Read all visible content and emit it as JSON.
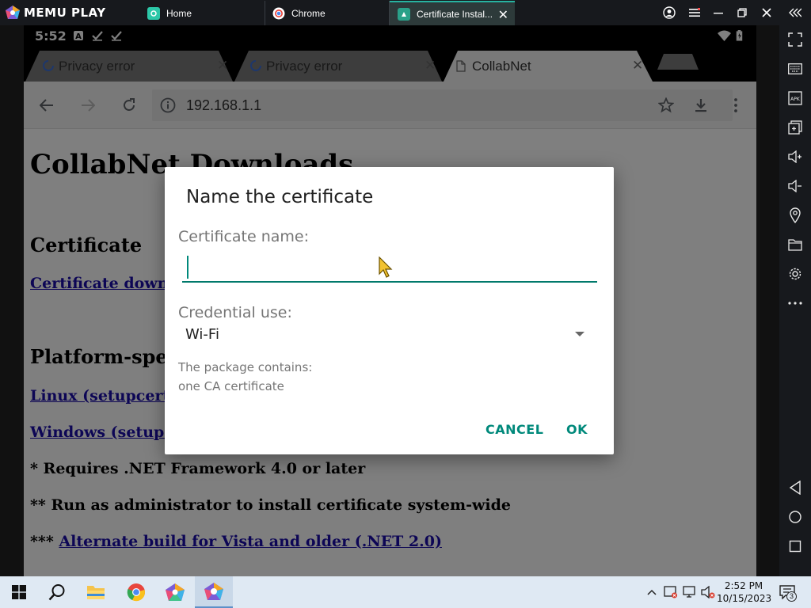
{
  "emulator": {
    "logo_text": "MEMU PLAY",
    "tabs": [
      {
        "label": "Home",
        "icon": "memu-home-icon"
      },
      {
        "label": "Chrome",
        "icon": "chrome-icon"
      },
      {
        "label": "Certificate Instal...",
        "icon": "certificate-installer-icon"
      }
    ]
  },
  "android": {
    "status_time": "5:52"
  },
  "chrome": {
    "tabs": [
      {
        "label": "Privacy error"
      },
      {
        "label": "Privacy error"
      },
      {
        "label": "CollabNet"
      }
    ],
    "url": "192.168.1.1"
  },
  "webpage": {
    "heading": "CollabNet Downloads",
    "section_certificate": "Certificate",
    "cert_download_link": "Certificate download",
    "section_platform": "Platform-specific",
    "linux_link": "Linux (setupcert)",
    "windows_link": "Windows (setupcert)",
    "note_1": "* Requires .NET Framework 4.0 or later",
    "note_2": "** Run as administrator to install certificate system-wide",
    "note_3_prefix": "*** ",
    "note_3_link": "Alternate build for Vista and older (.NET 2.0)"
  },
  "dialog": {
    "title": "Name the certificate",
    "name_label": "Certificate name:",
    "name_value": "",
    "credential_label": "Credential use:",
    "credential_value": "Wi-Fi",
    "package_line1": "The package contains:",
    "package_line2": "one CA certificate",
    "cancel_label": "CANCEL",
    "ok_label": "OK"
  },
  "taskbar": {
    "clock_time": "2:52 PM",
    "clock_date": "10/15/2023",
    "notification_count": "3"
  },
  "colors": {
    "accent": "#00897b",
    "memu_titlebar": "#17191d",
    "taskbar": "#dfe9f3"
  }
}
